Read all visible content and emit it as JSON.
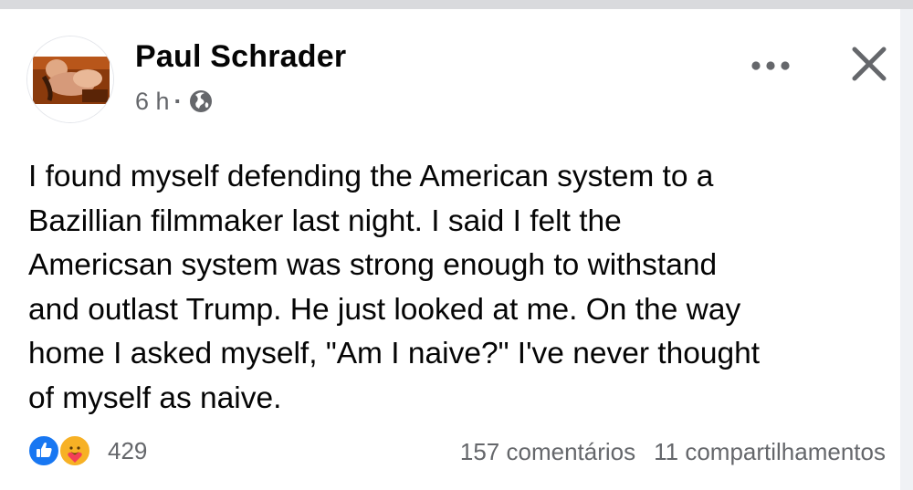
{
  "post": {
    "author": {
      "name": "Paul Schrader",
      "avatar_icon": "profile-photo"
    },
    "meta": {
      "time": "6 h",
      "separator": "·",
      "audience_icon": "globe-icon"
    },
    "actions": {
      "more_icon": "more-options-icon",
      "close_icon": "close-icon"
    },
    "text_lines": [
      "I found myself defending the American system to a",
      "Bazillian filmmaker last night. I said I felt the",
      "Americsan system was strong enough to withstand",
      "and outlast Trump. He just looked at me. On the way",
      "home I asked myself, \"Am I naive?\" I've never thought",
      "of myself as naive."
    ],
    "reactions": {
      "icons": [
        "like-icon",
        "care-icon"
      ],
      "count": "429"
    },
    "comments_label": "157 comentários",
    "shares_label": "11 compartilhamentos"
  },
  "colors": {
    "primary_text": "#050505",
    "secondary_text": "#65676b",
    "like_blue": "#1877f2",
    "care_yellow": "#f7b125",
    "top_bar": "#d9dadd"
  }
}
